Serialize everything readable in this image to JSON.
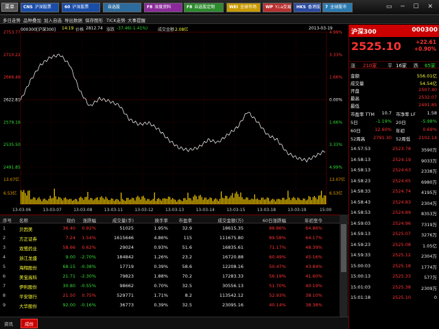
{
  "toolbar": {
    "menu": "菜单",
    "buttons": [
      {
        "key": "CNS",
        "label": "沪深股票",
        "color": "#1a4da8"
      },
      {
        "key": "60",
        "label": "沪深股票",
        "color": "#1a4da8"
      },
      {
        "key": "",
        "label": "自选股",
        "color": "#2d6b9d"
      },
      {
        "key": "F8",
        "label": "深度资料",
        "color": "#8a2a9a"
      },
      {
        "key": "F8",
        "label": "自选股定制",
        "color": "#2d8a2d"
      },
      {
        "key": "WEI",
        "label": "全球市场",
        "color": "#c89a00"
      },
      {
        "key": "WP",
        "label": "Y.i.a交易港",
        "color": "#b83030"
      },
      {
        "key": "HKS",
        "label": "香港股市",
        "color": "#2a4aa0"
      },
      {
        "key": "7",
        "label": "全球股市",
        "color": "#2a7ab0"
      }
    ],
    "window_controls": "▭ ─ ☐ ✕"
  },
  "subtabs": [
    "多日走势",
    "品种叠加",
    "加入自选",
    "导出数据",
    "保存图形",
    "TICK走势",
    "大事提醒"
  ],
  "info": {
    "code": "000300[沪深300]",
    "time": "14:19",
    "price_label": "价格",
    "price": "2812.74",
    "change_label": "涨跌",
    "change": "-37.46(-1.41%)",
    "vol_label": "成交金额",
    "vol": "2.08亿",
    "date": "2013-03-19"
  },
  "axis": {
    "left": [
      "2753.77",
      "2710.22",
      "2666.46",
      "2622.81",
      "2579.16",
      "2535.50",
      "2491.85",
      "13.07亿",
      "6.53亿"
    ],
    "right": [
      "4.99%",
      "3.33%",
      "1.66%",
      "0.00%",
      "1.66%",
      "3.33%",
      "4.99%",
      "13.07亿",
      "6.53亿"
    ],
    "dates": [
      "13-03-06",
      "13-03-07",
      "13-03-08",
      "13-03-11",
      "13-03-12",
      "13-03-13",
      "13-03-14",
      "13-03-15",
      "13-03-18",
      "13-03-19",
      "15:00"
    ]
  },
  "chart_data": {
    "type": "line",
    "title": "",
    "x_days": [
      "13-03-06",
      "13-03-07",
      "13-03-08",
      "13-03-11",
      "13-03-12",
      "13-03-13",
      "13-03-14",
      "13-03-15",
      "13-03-18",
      "13-03-19"
    ],
    "price": [
      2622,
      2660,
      2690,
      2705,
      2710,
      2690,
      2640,
      2610,
      2625,
      2620,
      2612,
      2585,
      2575,
      2578,
      2565,
      2545,
      2530,
      2525,
      2530,
      2545,
      2540,
      2555,
      2570,
      2600,
      2580,
      2555,
      2545,
      2520,
      2510,
      2505,
      2515,
      2525
    ],
    "volume": [
      6.2,
      3.1,
      2.5,
      3.8,
      3.0,
      2.4,
      3.3,
      2.8,
      3.5,
      2.6,
      2.3,
      2.9,
      3.7,
      2.4,
      2.7,
      3.4,
      2.2,
      2.8,
      4.1,
      3.0,
      2.6,
      3.8,
      5.5,
      3.1,
      2.5,
      3.0,
      2.4,
      2.9,
      3.2,
      2.6,
      3.6,
      4.0
    ],
    "ylim": [
      2491.85,
      2753.77
    ],
    "ylabel": "",
    "xlabel": ""
  },
  "table": {
    "headers": [
      "序号",
      "名称",
      "现价",
      "涨跌幅",
      "成交量(手)",
      "换手率",
      "市盈率",
      "成交金额(万)",
      "60日涨跌幅",
      "年初至今"
    ],
    "rows": [
      [
        "1",
        "贝因美",
        "36.40",
        "0.92%",
        "51025",
        "1.95%",
        "32.9",
        "18615.35",
        "88.86%",
        "64.86%"
      ],
      [
        "2",
        "方正证券",
        "7.24",
        "1.54%",
        "1615646",
        "4.86%",
        "115",
        "111675.80",
        "89.58%",
        "64.17%"
      ],
      [
        "3",
        "双鹭药业",
        "58.66",
        "0.62%",
        "29024",
        "0.93%",
        "51.6",
        "16835.61",
        "71.17%",
        "48.39%"
      ],
      [
        "4",
        "浙江龙盛",
        "9.00",
        "-2.70%",
        "184842",
        "1.26%",
        "23.2",
        "16720.88",
        "60.49%",
        "45.16%"
      ],
      [
        "5",
        "海翔股份",
        "68.15",
        "-0.38%",
        "17719",
        "0.39%",
        "58.6",
        "12208.16",
        "50.47%",
        "43.84%"
      ],
      [
        "6",
        "美宝高科",
        "21.71",
        "-2.30%",
        "79823",
        "1.88%",
        "70.2",
        "17283.33",
        "56.19%",
        "41.60%"
      ],
      [
        "7",
        "伊利股份",
        "30.80",
        "-0.55%",
        "98662",
        "0.70%",
        "32.5",
        "30556.13",
        "51.70%",
        "40.19%"
      ],
      [
        "8",
        "平安银行",
        "21.50",
        "0.75%",
        "529771",
        "1.71%",
        "8.2",
        "113542.12",
        "52.93%",
        "38.10%"
      ],
      [
        "9",
        "大华股份",
        "92.00",
        "-0.16%",
        "36773",
        "0.39%",
        "32.5",
        "23095.16",
        "40.14%",
        "38.38%"
      ]
    ]
  },
  "tabs": {
    "t1": "资讯",
    "t2": "成份"
  },
  "side": {
    "name": "沪深300",
    "code": "000300",
    "price": "2525.10",
    "chg": "+22.61",
    "pct": "+0.90%",
    "breadth": {
      "up_label": "涨",
      "up": "210家",
      "flat_label": "平",
      "flat": "16家",
      "down_label": "跌",
      "down": "65家"
    },
    "stats": [
      {
        "label": "金额",
        "value": "556.01亿"
      },
      {
        "label": "成交量",
        "value": "54.54亿"
      },
      {
        "label": "开盘",
        "value": "2507.40"
      },
      {
        "label": "最高",
        "value": "2532.07"
      },
      {
        "label": "最低",
        "value": "2491.85"
      }
    ],
    "ratios": [
      [
        "市盈率 TTM",
        "10.7",
        "市净率 LF",
        "1.58"
      ],
      [
        "5日",
        "-1.19%",
        "20日",
        "-5.98%"
      ],
      [
        "60日",
        "12.60%",
        "年初",
        "0.69%"
      ],
      [
        "52周高",
        "2791.30",
        "52周低",
        "2102.14"
      ]
    ],
    "ticks": [
      [
        "14:57:53",
        "2523.78",
        "3590万"
      ],
      [
        "14:58:13",
        "2524.19",
        "9033万"
      ],
      [
        "14:58:13",
        "2524.63",
        "2338万"
      ],
      [
        "14:58:23",
        "2524.65",
        "6980万"
      ],
      [
        "14:58:33",
        "2524.74",
        "4195万"
      ],
      [
        "14:58:43",
        "2524.83",
        "2304万"
      ],
      [
        "14:58:53",
        "2524.89",
        "8353万"
      ],
      [
        "14:59:03",
        "2524.96",
        "7319万"
      ],
      [
        "14:59:13",
        "2525.07",
        "3276万"
      ],
      [
        "14:59:23",
        "2525.08",
        "1.05亿"
      ],
      [
        "14:59:33",
        "2525.12",
        "2304万"
      ],
      [
        "15:00:03",
        "2525.18",
        "1774万"
      ],
      [
        "15:00:13",
        "2525.33",
        "577万"
      ],
      [
        "15:01:03",
        "2525.38",
        "2309万"
      ],
      [
        "15:01:18",
        "2525.10",
        "0"
      ]
    ]
  }
}
